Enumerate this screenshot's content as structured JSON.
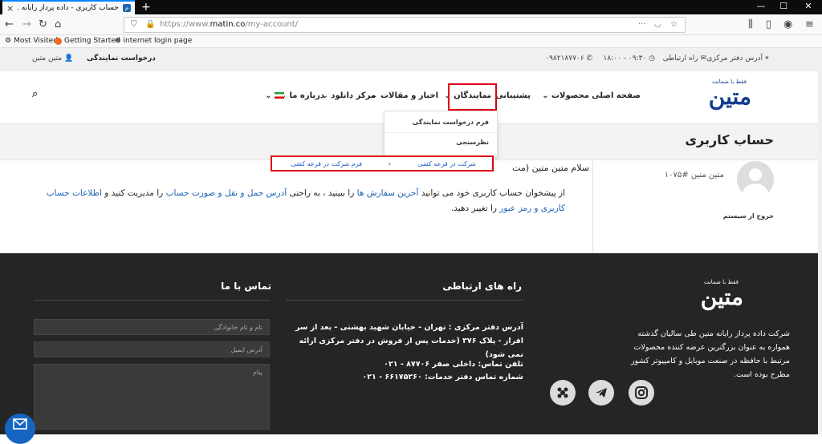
{
  "browser": {
    "tab_title": "حساب کاربری - داده پرداز رایانه ...",
    "tab_favicon": "site-favicon",
    "url_prefix": "https://www.",
    "url_domain": "matin.co",
    "url_path": "/my-account/",
    "more_dots": "···",
    "bookmarks": [
      "Most Visited",
      "Getting Started",
      "internet login page"
    ]
  },
  "topbar": {
    "address": "آدرس دفتر مرکزی",
    "contact": "راه ارتباطی",
    "hours": "۰۹:۳۰ - ۱۸:۰۰",
    "phone": "۰۹۸۲۱۸۷۷۰۶",
    "user": "متین متین",
    "request": "درخواست نمایندگی"
  },
  "header": {
    "logo_text": "متین",
    "logo_tag": "فقط با ضمانت",
    "menu": [
      "صفحه اصلی",
      "محصولات",
      "پشتیبانی",
      "نمایندگان",
      "اخبار و مقالات",
      "مرکز دانلود",
      "درباره ما"
    ]
  },
  "dropdown": {
    "items": [
      "فرم درخواست نمایندگی",
      "نظرسنجی",
      "شرکت در قرعه کشی"
    ],
    "submenu_item": "فرم شرکت در قرعه کشی",
    "submenu_arrow": "›"
  },
  "page": {
    "title": "حساب کاربری"
  },
  "account": {
    "name": "متین متین",
    "id": "#۱۰۷۵",
    "logout": "خروج از سیستم",
    "greeting": "سلام متین متین (مت",
    "para_1": "از پیشخوان حساب کاربری خود می توانید ",
    "link_orders": "آخرین سفارش ها",
    "para_2": " را ببینید ، به راحتی ",
    "link_addresses": "آدرس حمل و نقل و صورت حساب",
    "para_3": " را مدیریت کنید و ",
    "link_details": "اطلاعات حساب کاربری و رمز عبور",
    "para_4": " را تغییر دهید."
  },
  "footer": {
    "about": "شرکت داده پرداز رایانه متین طی سالیان گذشته همواره به عنوان بزرگترین عرضه کننده محصولات مرتبط با حافظه در صنعت موبایل و کامپیوتر کشور مطرح بوده است.",
    "contact_title": "راه های ارتباطی",
    "address": "آدرس دفتر مرکزی : تهران - خیابان شهید بهشتی - بعد از سر افراز - پلاک ۳۷۶ (خدمات پس از فروش در دفتر مرکزی ارائه نمی شود)",
    "phone": "تلفن تماس: داخلی صفر ۸۷۷۰۶ - ۰۲۱",
    "service_phone": "شماره تماس دفتر خدمات: ۶۶۱۷۵۲۶۰ - ۰۲۱",
    "form_title": "تماس با ما",
    "name_placeholder": "نام و نام خانوادگی",
    "email_placeholder": "آدرس ایمیل",
    "message_placeholder": "پیام"
  },
  "colors": {
    "accent": "#1a5fb4",
    "highlight": "#e00016",
    "footer_bg": "#252525"
  }
}
